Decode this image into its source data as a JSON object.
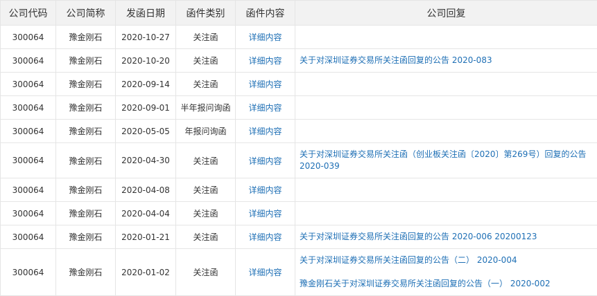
{
  "table": {
    "columns": [
      "公司代码",
      "公司简称",
      "发函日期",
      "函件类别",
      "函件内容",
      "公司回复"
    ],
    "rows": [
      {
        "code": "300064",
        "name": "豫金刚石",
        "date": "2020-10-27",
        "category": "关注函",
        "content": "详细内容",
        "replies": []
      },
      {
        "code": "300064",
        "name": "豫金刚石",
        "date": "2020-10-20",
        "category": "关注函",
        "content": "详细内容",
        "replies": [
          "关于对深圳证券交易所关注函回复的公告 2020-083"
        ]
      },
      {
        "code": "300064",
        "name": "豫金刚石",
        "date": "2020-09-14",
        "category": "关注函",
        "content": "详细内容",
        "replies": []
      },
      {
        "code": "300064",
        "name": "豫金刚石",
        "date": "2020-09-01",
        "category": "半年报问询函",
        "content": "详细内容",
        "replies": []
      },
      {
        "code": "300064",
        "name": "豫金刚石",
        "date": "2020-05-05",
        "category": "年报问询函",
        "content": "详细内容",
        "replies": []
      },
      {
        "code": "300064",
        "name": "豫金刚石",
        "date": "2020-04-30",
        "category": "关注函",
        "content": "详细内容",
        "replies": [
          "关于对深圳证券交易所关注函（创业板关注函〔2020〕第269号）回复的公告 2020-039"
        ]
      },
      {
        "code": "300064",
        "name": "豫金刚石",
        "date": "2020-04-08",
        "category": "关注函",
        "content": "详细内容",
        "replies": []
      },
      {
        "code": "300064",
        "name": "豫金刚石",
        "date": "2020-04-04",
        "category": "关注函",
        "content": "详细内容",
        "replies": []
      },
      {
        "code": "300064",
        "name": "豫金刚石",
        "date": "2020-01-21",
        "category": "关注函",
        "content": "详细内容",
        "replies": [
          "关于对深圳证券交易所关注函回复的公告 2020-006 20200123"
        ]
      },
      {
        "code": "300064",
        "name": "豫金刚石",
        "date": "2020-01-02",
        "category": "关注函",
        "content": "详细内容",
        "replies": [
          "关于对深圳证券交易所关注函回复的公告（二） 2020-004",
          "豫金刚石关于对深圳证券交易所关注函回复的公告（一） 2020-002"
        ]
      }
    ]
  },
  "colors": {
    "link": "#1e6fb5",
    "header_bg": "#f2f2f2",
    "border": "#e5e5e5",
    "text": "#333333"
  }
}
